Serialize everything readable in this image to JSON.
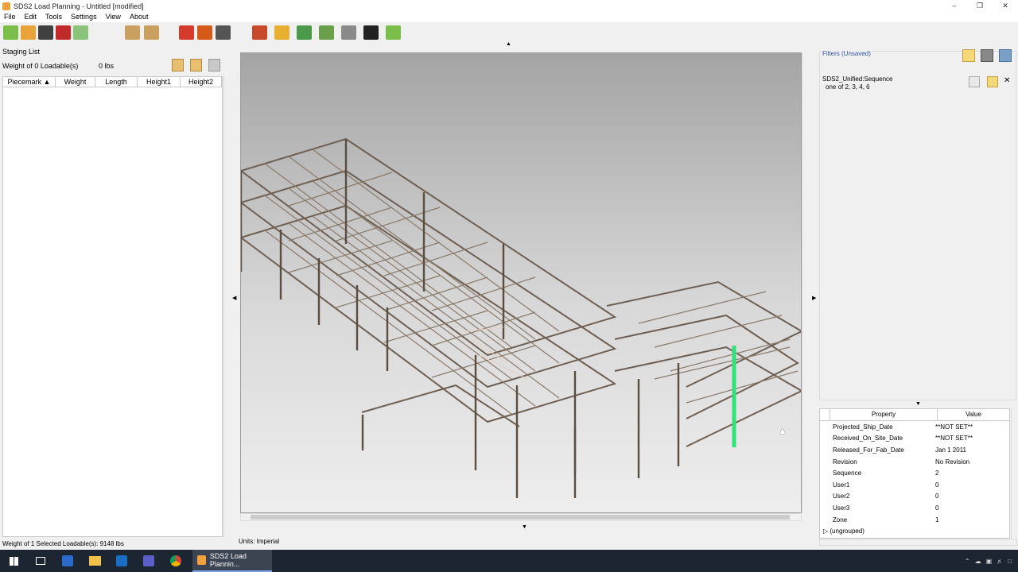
{
  "window": {
    "title": "SDS2 Load Planning - Untitled [modified]"
  },
  "menu": [
    "File",
    "Edit",
    "Tools",
    "Settings",
    "View",
    "About"
  ],
  "toolbar_icons": [
    {
      "name": "new-icon",
      "color": "#7bbf4a"
    },
    {
      "name": "open-icon",
      "color": "#e8a33a"
    },
    {
      "name": "save-icon",
      "color": "#404040"
    },
    {
      "name": "undo-icon",
      "color": "#c22a2a"
    },
    {
      "name": "redo-icon",
      "color": "#8ac47a"
    },
    {
      "name": "load-add-icon",
      "color": "#c9a060"
    },
    {
      "name": "load-remove-icon",
      "color": "#c9a060"
    },
    {
      "name": "truck-load-icon",
      "color": "#d43b2a"
    },
    {
      "name": "stop-icon",
      "color": "#d45a1a"
    },
    {
      "name": "delete-load-icon",
      "color": "#555555"
    },
    {
      "name": "member-color-icon",
      "color": "#c84a2a"
    },
    {
      "name": "lock-icon",
      "color": "#e8b030"
    },
    {
      "name": "ship-date-icon",
      "color": "#4a9a4a"
    },
    {
      "name": "site-date-icon",
      "color": "#6aa04a"
    },
    {
      "name": "erection-icon",
      "color": "#8a8a8a"
    },
    {
      "name": "target-icon",
      "color": "#222222"
    },
    {
      "name": "approve-icon",
      "color": "#7bbf4a"
    }
  ],
  "staging": {
    "title": "Staging List",
    "weight_label": "Weight of 0 Loadable(s)",
    "weight_value": "0 lbs",
    "columns": [
      "Piecemark",
      "Weight",
      "Length",
      "Height1",
      "Height2"
    ]
  },
  "filters": {
    "title": "Filters (Unsaved)",
    "item_name": "SDS2_Unified:Sequence",
    "item_detail": "one of 2, 3, 4, 6"
  },
  "properties": {
    "columns": [
      "Property",
      "Value"
    ],
    "rows": [
      {
        "key": "Projected_Ship_Date",
        "value": "**NOT SET**"
      },
      {
        "key": "Received_On_Site_Date",
        "value": "**NOT SET**"
      },
      {
        "key": "Released_For_Fab_Date",
        "value": "Jan 1 2011"
      },
      {
        "key": "Revision",
        "value": "No Revision"
      },
      {
        "key": "Sequence",
        "value": "2"
      },
      {
        "key": "User1",
        "value": "0"
      },
      {
        "key": "User2",
        "value": "0"
      },
      {
        "key": "User3",
        "value": "0"
      },
      {
        "key": "Zone",
        "value": "1"
      }
    ],
    "group": "(ungrouped)"
  },
  "status": {
    "selected": "Weight of 1 Selected Loadable(s): 9148 lbs",
    "units": "Units: Imperial"
  },
  "taskbar": {
    "app_label": "SDS2 Load Plannin...",
    "icons": [
      "windows-start-icon",
      "task-view-icon",
      "vm-icon",
      "explorer-icon",
      "outlook-icon",
      "teams-icon",
      "chrome-icon"
    ]
  },
  "colors": {
    "selected_member": "#33e07a",
    "steel": "#8a7a6a",
    "filter_title": "#3355aa"
  }
}
